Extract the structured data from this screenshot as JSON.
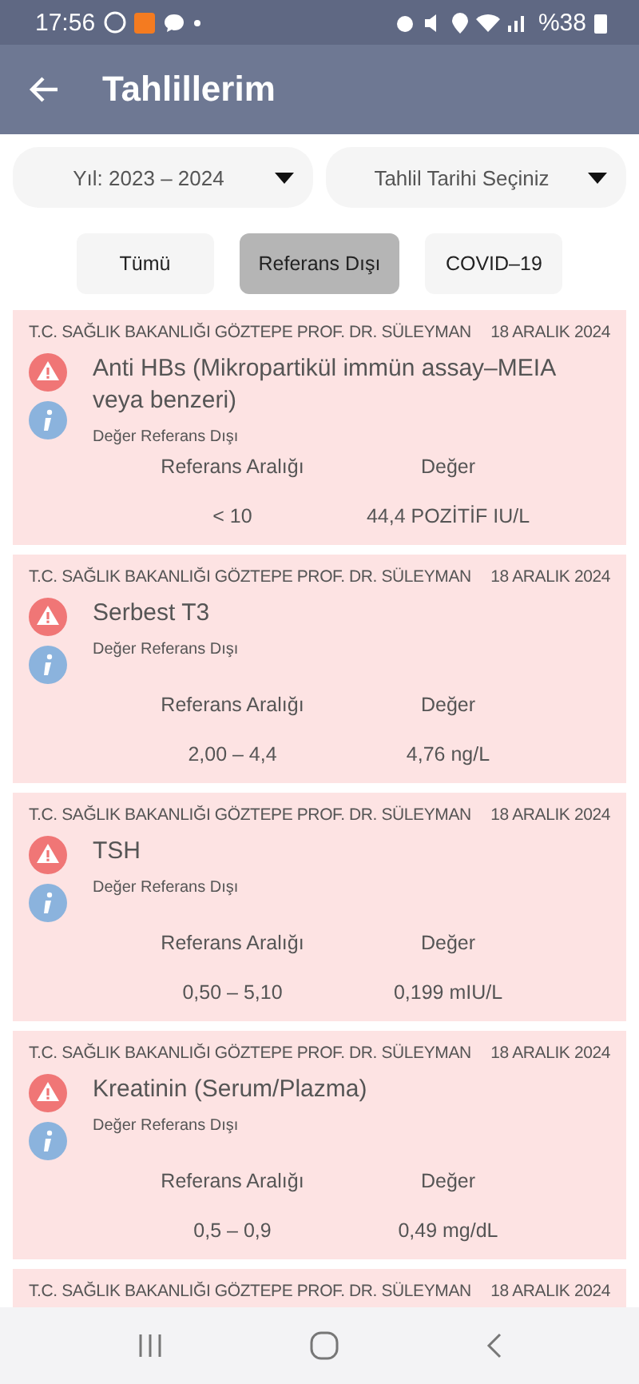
{
  "status_bar": {
    "time": "17:56",
    "battery": "%38"
  },
  "app_bar": {
    "title": "Tahlillerim"
  },
  "filters": [
    {
      "label": "Yıl: 2023 – 2024"
    },
    {
      "label": "Tahlil Tarihi Seçiniz"
    }
  ],
  "tabs": [
    {
      "label": "Tümü",
      "selected": false
    },
    {
      "label": "Referans Dışı",
      "selected": true
    },
    {
      "label": "COVID–19",
      "selected": false
    }
  ],
  "results": [
    {
      "hospital": "T.C. SAĞLIK BAKANLIĞI GÖZTEPE PROF. DR. SÜLEYMAN",
      "date": "18 ARALIK 2024",
      "test": "Anti HBs  (Mikropartikül immün assay–MEIA veya benzeri)",
      "status": "Değer Referans Dışı",
      "range_label": "Referans Aralığı",
      "value_label": "Değer",
      "range": "< 10",
      "value": "44,4 POZİTİF IU/L"
    },
    {
      "hospital": "T.C. SAĞLIK BAKANLIĞI GÖZTEPE PROF. DR. SÜLEYMAN",
      "date": "18 ARALIK 2024",
      "test": "Serbest T3",
      "status": "Değer Referans Dışı",
      "range_label": "Referans Aralığı",
      "value_label": "Değer",
      "range": "2,00 – 4,4",
      "value": "4,76 ng/L"
    },
    {
      "hospital": "T.C. SAĞLIK BAKANLIĞI GÖZTEPE PROF. DR. SÜLEYMAN",
      "date": "18 ARALIK 2024",
      "test": "TSH",
      "status": "Değer Referans Dışı",
      "range_label": "Referans Aralığı",
      "value_label": "Değer",
      "range": "0,50 – 5,10",
      "value": "0,199 mIU/L"
    },
    {
      "hospital": "T.C. SAĞLIK BAKANLIĞI GÖZTEPE PROF. DR. SÜLEYMAN",
      "date": "18 ARALIK 2024",
      "test": "Kreatinin (Serum/Plazma)",
      "status": "Değer Referans Dışı",
      "range_label": "Referans Aralığı",
      "value_label": "Değer",
      "range": "0,5 – 0,9",
      "value": "0,49 mg/dL"
    },
    {
      "hospital": "T.C. SAĞLIK BAKANLIĞI GÖZTEPE PROF. DR. SÜLEYMAN",
      "date": "18 ARALIK 2024"
    }
  ]
}
